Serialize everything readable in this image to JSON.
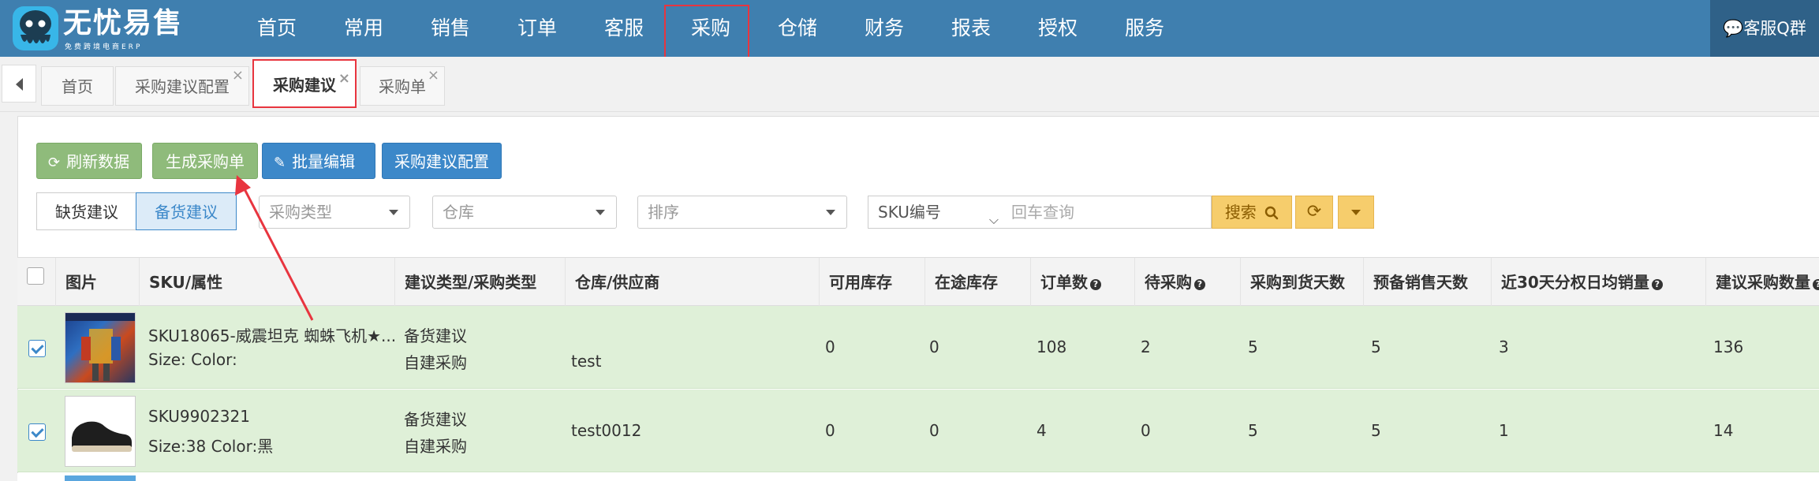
{
  "app": {
    "logo_title": "无忧易售",
    "logo_sub": "免费跨境电商ERP",
    "nav": [
      "首页",
      "常用",
      "销售",
      "订单",
      "客服",
      "采购",
      "仓储",
      "财务",
      "报表",
      "授权",
      "服务"
    ],
    "active_nav": "采购",
    "kefu_label": "客服Q群"
  },
  "tabs": [
    {
      "label": "首页",
      "closable": false
    },
    {
      "label": "采购建议配置",
      "closable": true
    },
    {
      "label": "采购建议",
      "closable": true,
      "active": true
    },
    {
      "label": "采购单",
      "closable": true
    }
  ],
  "toolbar": {
    "refresh_label": "刷新数据",
    "generate_label": "生成采购单",
    "batch_edit_label": "批量编辑",
    "config_label": "采购建议配置"
  },
  "filters": {
    "segment": [
      "缺货建议",
      "备货建议"
    ],
    "segment_active": "备货建议",
    "purchase_type_placeholder": "采购类型",
    "warehouse_placeholder": "仓库",
    "sort_placeholder": "排序",
    "sku_field": "SKU编号",
    "query_placeholder": "回车查询",
    "search_label": "搜索"
  },
  "table": {
    "headers": [
      "图片",
      "SKU/属性",
      "建议类型/采购类型",
      "仓库/供应商",
      "可用库存",
      "在途库存",
      "订单数",
      "待采购",
      "采购到货天数",
      "预备销售天数",
      "近30天分权日均销量",
      "建议采购数量"
    ],
    "header_help": [
      false,
      false,
      false,
      false,
      false,
      false,
      true,
      true,
      false,
      false,
      true,
      true
    ],
    "rows": [
      {
        "checked": true,
        "sku": "SKU18065-威震坦克 蜘蛛飞机★...",
        "attrs": "Size: Color:",
        "suggest_type": "备货建议",
        "purchase_type": "自建采购",
        "warehouse": "test",
        "available": "0",
        "in_transit": "0",
        "orders": "108",
        "pending": "2",
        "arrival_days": "5",
        "sale_days": "5",
        "avg_sales": "3",
        "suggest_qty": "136"
      },
      {
        "checked": true,
        "sku": "SKU9902321",
        "attrs": "Size:38 Color:黑",
        "suggest_type": "备货建议",
        "purchase_type": "自建采购",
        "warehouse": "test0012",
        "available": "0",
        "in_transit": "0",
        "orders": "4",
        "pending": "0",
        "arrival_days": "5",
        "sale_days": "5",
        "avg_sales": "1",
        "suggest_qty": "14"
      }
    ]
  },
  "colors": {
    "header_bg": "#3f7faf",
    "accent_blue": "#3c88c9",
    "accent_green": "#8fbb7b",
    "search_yellow": "#f6cd6c",
    "row_green": "#dff0d8",
    "annotation_red": "#e8353f"
  }
}
